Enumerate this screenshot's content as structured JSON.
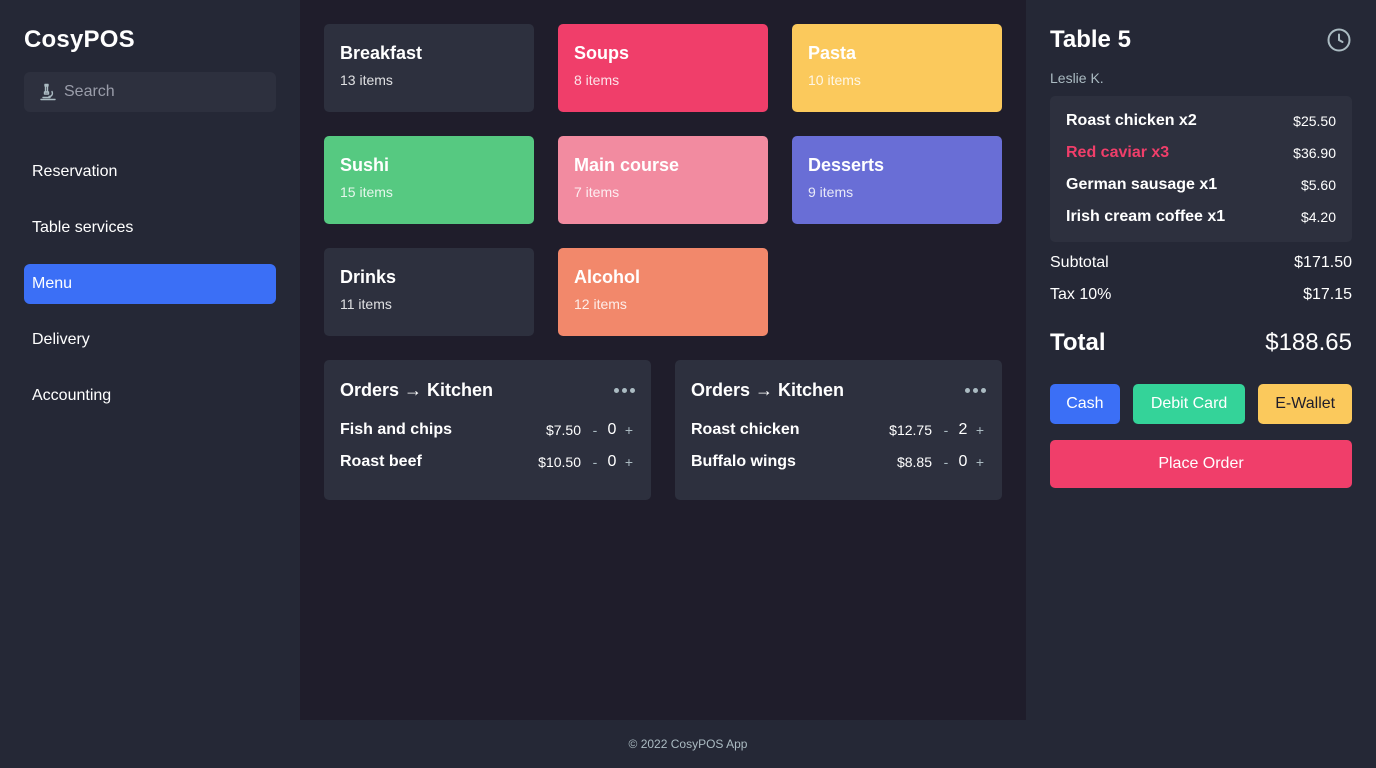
{
  "app": {
    "title": "CosyPOS"
  },
  "search": {
    "placeholder": "Search",
    "icon": "microscope-icon"
  },
  "nav": {
    "items": [
      {
        "label": "Reservation",
        "active": false
      },
      {
        "label": "Table services",
        "active": false
      },
      {
        "label": "Menu",
        "active": true
      },
      {
        "label": "Delivery",
        "active": false
      },
      {
        "label": "Accounting",
        "active": false
      }
    ]
  },
  "categories": [
    {
      "name": "Breakfast",
      "count": "13 items",
      "color": "#2d303e",
      "text_color": "#ffffff"
    },
    {
      "name": "Soups",
      "count": "8 items",
      "color": "#f03e6a",
      "text_color": "#ffffff"
    },
    {
      "name": "Pasta",
      "count": "10 items",
      "color": "#fbc95c",
      "text_color": "#ffffff"
    },
    {
      "name": "Sushi",
      "count": "15 items",
      "color": "#56c981",
      "text_color": "#ffffff"
    },
    {
      "name": "Main course",
      "count": "7 items",
      "color": "#f28ba0",
      "text_color": "#ffffff"
    },
    {
      "name": "Desserts",
      "count": "9 items",
      "color": "#696ed6",
      "text_color": "#ffffff"
    },
    {
      "name": "Drinks",
      "count": "11 items",
      "color": "#2d303e",
      "text_color": "#ffffff"
    },
    {
      "name": "Alcohol",
      "count": "12 items",
      "color": "#f2886b",
      "text_color": "#ffffff"
    }
  ],
  "orders": [
    {
      "title": "Orders → Kitchen",
      "items": [
        {
          "name": "Fish and chips",
          "price": "$7.50",
          "qty": "0"
        },
        {
          "name": "Roast beef",
          "price": "$10.50",
          "qty": "0"
        }
      ]
    },
    {
      "title": "Orders → Kitchen",
      "items": [
        {
          "name": "Roast chicken",
          "price": "$12.75",
          "qty": "2"
        },
        {
          "name": "Buffalo wings",
          "price": "$8.85",
          "qty": "0"
        }
      ]
    }
  ],
  "controls": {
    "minus": "-",
    "plus": "+"
  },
  "table": {
    "title": "Table 5",
    "customer": "Leslie K.",
    "bill": [
      {
        "name": "Roast chicken x2",
        "price": "$25.50",
        "highlight": false
      },
      {
        "name": "Red caviar x3",
        "price": "$36.90",
        "highlight": true
      },
      {
        "name": "German sausage x1",
        "price": "$5.60",
        "highlight": false
      },
      {
        "name": "Irish cream coffee x1",
        "price": "$4.20",
        "highlight": false
      }
    ],
    "subtotal_label": "Subtotal",
    "subtotal": "$171.50",
    "tax_label": "Tax 10%",
    "tax": "$17.15",
    "total_label": "Total",
    "total": "$188.65"
  },
  "payment": {
    "cash": "Cash",
    "debit": "Debit Card",
    "wallet": "E-Wallet"
  },
  "place_order": "Place Order",
  "footer": "© 2022 CosyPOS App",
  "colors": {
    "accent": "#3b6ff6",
    "danger": "#f03e6a",
    "success": "#34d399",
    "warning": "#fbc95c"
  }
}
